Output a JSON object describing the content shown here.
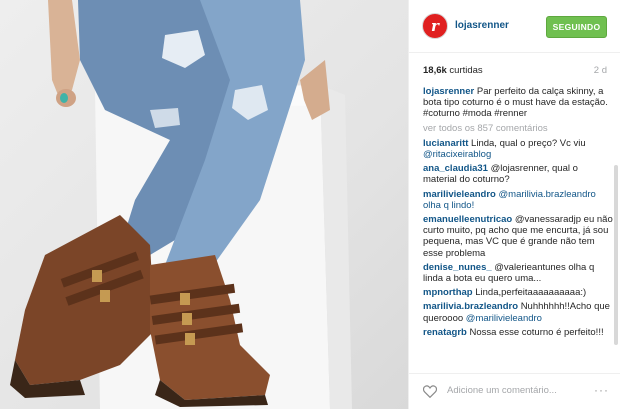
{
  "post": {
    "username": "lojasrenner",
    "follow_label": "SEGUINDO",
    "likes_count": "18,6k",
    "likes_label": "curtidas",
    "time_ago": "2 d",
    "caption": "Par perfeito da calça skinny, a bota tipo coturno é o must have da estação. #coturno #moda #renner",
    "view_all": "ver todos os 857 comentários"
  },
  "comments": [
    {
      "user": "lucianaritt",
      "text": "Linda, qual o preço? Vc viu ",
      "mention": "@ritacixeirablog"
    },
    {
      "user": "ana_claudia31",
      "text": "@lojasrenner, qual o material do coturno?",
      "mention": ""
    },
    {
      "user": "marilivieleandro",
      "text": "",
      "mention": "@marilivia.brazleandro olha q lindo!"
    },
    {
      "user": "emanuelleenutricao",
      "text": "",
      "mention": "@vanessaradjp eu não curto muito, pq acho que me encurta, já sou pequena, mas VC que é grande não tem esse problema"
    },
    {
      "user": "denise_nunes_",
      "text": "",
      "mention": "@valerieantunes olha q linda a bota eu quero uma..."
    },
    {
      "user": "mpnorthap",
      "text": "Linda,perfeitaaaaaaaaaa:)",
      "mention": ""
    },
    {
      "user": "marilivia.brazleandro",
      "text": "Nuhhhhhh!!Acho que queroooo ",
      "mention": "@marilivieleandro"
    },
    {
      "user": "renatagrb",
      "text": "Nossa esse coturno é perfeito!!!",
      "mention": ""
    }
  ],
  "footer": {
    "comment_placeholder": "Adicione um comentário...",
    "more_label": "···"
  },
  "colors": {
    "link": "#125688",
    "follow_bg": "#70c050",
    "brand": "#e02020"
  }
}
